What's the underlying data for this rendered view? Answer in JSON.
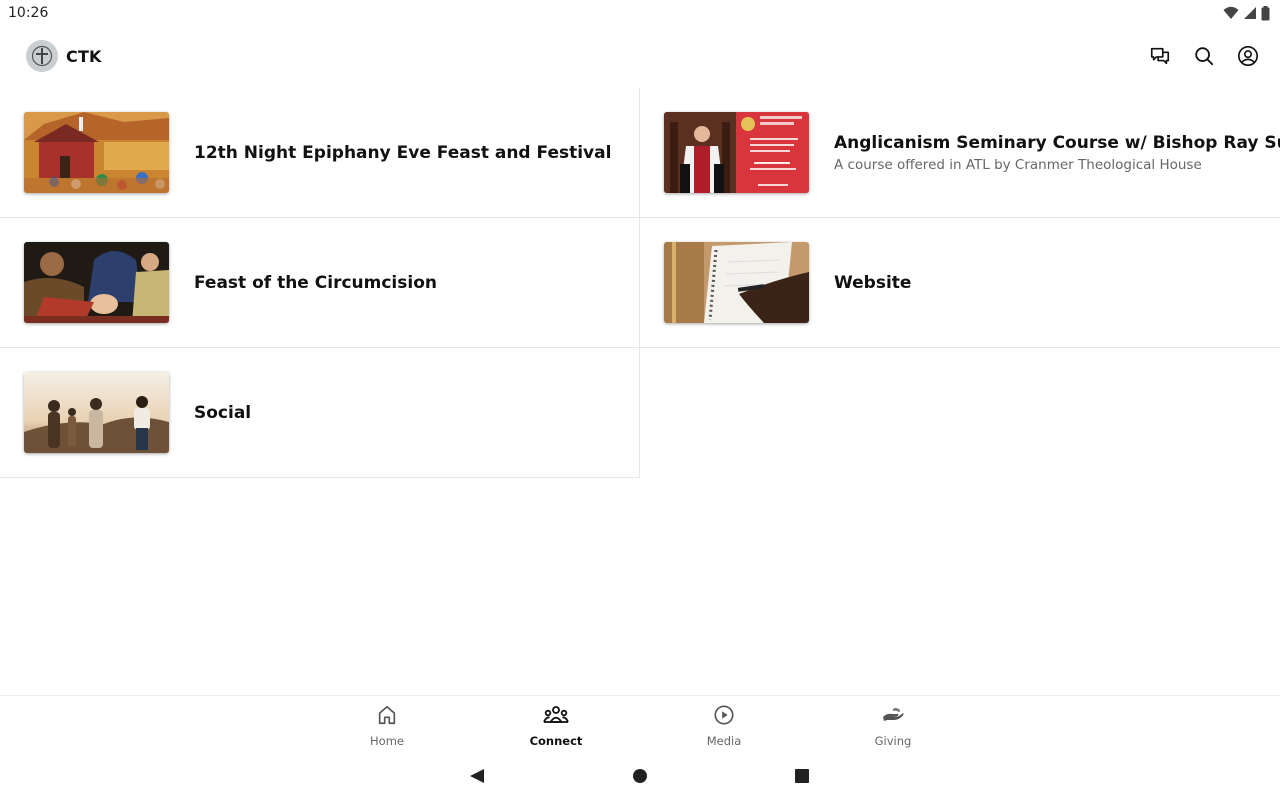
{
  "status": {
    "time": "10:26"
  },
  "app": {
    "name": "CTK"
  },
  "actions": [
    {
      "name": "chat-icon"
    },
    {
      "name": "search-icon"
    },
    {
      "name": "account-icon"
    }
  ],
  "items": [
    {
      "title": "12th Night Epiphany Eve Feast and Festival",
      "subtitle": "",
      "thumb": "folk-festival-painting"
    },
    {
      "title": "Anglicanism Seminary Course w/ Bishop Ray Sutton",
      "subtitle": "A course offered in ATL by Cranmer Theological House",
      "thumb": "bishop-poster"
    },
    {
      "title": "Feast of the Circumcision",
      "subtitle": "",
      "thumb": "renaissance-painting"
    },
    {
      "title": "Website",
      "subtitle": "",
      "thumb": "notebook-writing"
    },
    {
      "title": "Social",
      "subtitle": "",
      "thumb": "people-sunset"
    }
  ],
  "nav": [
    {
      "label": "Home",
      "icon": "home-icon",
      "active": false
    },
    {
      "label": "Connect",
      "icon": "people-icon",
      "active": true
    },
    {
      "label": "Media",
      "icon": "play-circle-icon",
      "active": false
    },
    {
      "label": "Giving",
      "icon": "giving-hand-icon",
      "active": false
    }
  ],
  "colors": {
    "accent": "#111111",
    "divider": "#e6e6e6",
    "muted": "#666666"
  }
}
